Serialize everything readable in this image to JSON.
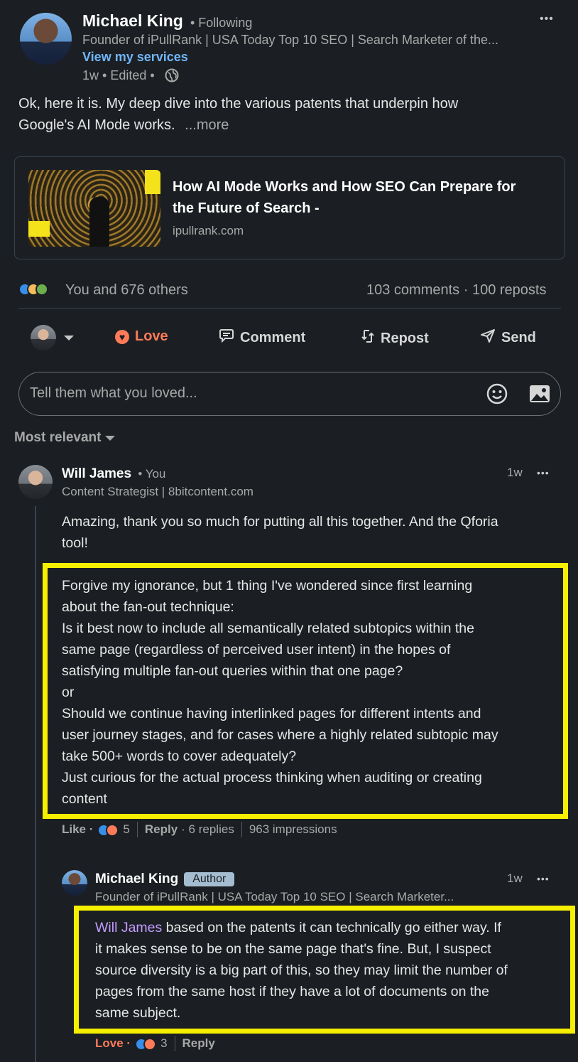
{
  "post": {
    "author_name": "Michael King",
    "follow_status": "• Following",
    "author_headline": "Founder of iPullRank | USA Today Top 10 SEO | Search Marketer of the...",
    "services_link": "View my services",
    "timestamp": "1w • Edited •",
    "body_line1": "Ok, here it is. My deep dive into the various patents that underpin how",
    "body_line2": "Google's AI Mode works.",
    "more_link": "...more",
    "menu": "•••"
  },
  "link_card": {
    "title_line1": "How AI Mode Works and How SEO Can Prepare for",
    "title_line2": "the Future of Search -",
    "domain": "ipullrank.com"
  },
  "stats": {
    "reactions_text": "You and 676 others",
    "comments_reposts": "103 comments · 100 reposts"
  },
  "actions": {
    "love": "Love",
    "comment": "Comment",
    "repost": "Repost",
    "send": "Send"
  },
  "composer": {
    "placeholder": "Tell them what you loved..."
  },
  "sort": {
    "label": "Most relevant"
  },
  "comment1": {
    "name": "Will James",
    "you_tag": "• You",
    "headline": "Content Strategist | 8bitcontent.com",
    "time": "1w",
    "menu": "•••",
    "text_line1": "Amazing, thank you so much for putting all this together. And the Qforia",
    "text_line2": "tool!",
    "hl_lines": [
      "Forgive my ignorance, but 1 thing I've wondered since first learning",
      "about the fan-out technique:",
      "Is it best now to include all semantically related subtopics within the",
      "same page (regardless of perceived user intent) in the hopes of",
      "satisfying multiple fan-out queries within that one page?",
      "or",
      "Should we continue having interlinked pages for different intents and",
      "user journey stages, and for cases where a highly related subtopic may",
      "take 500+ words to cover adequately?",
      "Just curious for the actual process thinking when auditing or creating",
      "content"
    ],
    "like": "Like ·",
    "reaction_count": "5",
    "reply": "Reply",
    "replies": "· 6 replies",
    "impressions": "963 impressions"
  },
  "reply1": {
    "name": "Michael King",
    "badge": "Author",
    "headline": "Founder of iPullRank | USA Today Top 10 SEO | Search Marketer...",
    "time": "1w",
    "menu": "•••",
    "mention": "Will James",
    "line1_rest": " based on the patents it can technically go either way. If",
    "lines": [
      "it makes sense to be on the same page that's fine. But, I suspect",
      "source diversity is a big part of this, so they may limit the number of",
      "pages from the same host if they have a lot of documents on the",
      "same subject."
    ],
    "love": "Love ·",
    "reaction_count": "3",
    "reply": "Reply"
  },
  "colors": {
    "background": "#1b1f23",
    "link_blue": "#70b5f9",
    "love_red": "#ff7a59",
    "highlight_yellow": "#f6ef00",
    "mention_purple": "#c39bff"
  }
}
